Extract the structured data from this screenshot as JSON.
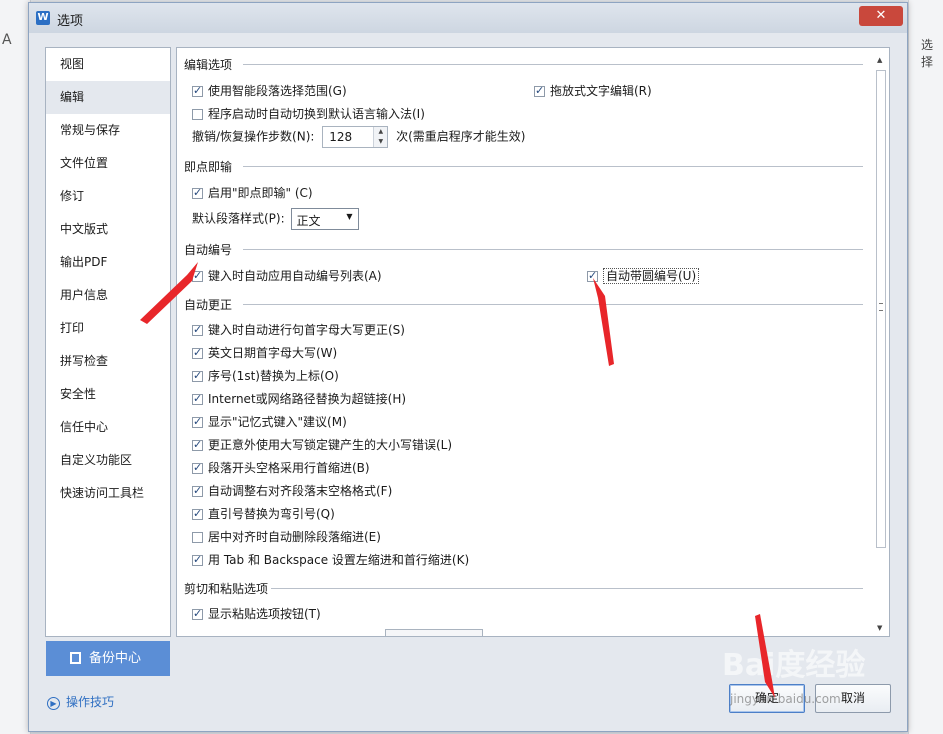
{
  "background": {
    "left_glyph": "A",
    "right_text": "选择"
  },
  "dialog": {
    "title": "选项",
    "close": "✕"
  },
  "sidebar": {
    "items": [
      "视图",
      "编辑",
      "常规与保存",
      "文件位置",
      "修订",
      "中文版式",
      "输出PDF",
      "用户信息",
      "打印",
      "拼写检查",
      "安全性",
      "信任中心",
      "自定义功能区",
      "快速访问工具栏"
    ],
    "active_index": 1
  },
  "backup_button": "备份中心",
  "tips_link": "操作技巧",
  "sections": {
    "edit_options": {
      "title": "编辑选项",
      "smart_select": {
        "label": "使用智能段落选择范围(G)",
        "checked": true
      },
      "drag_drop": {
        "label": "拖放式文字编辑(R)",
        "checked": true
      },
      "auto_ime": {
        "label": "程序启动时自动切换到默认语言输入法(I)",
        "checked": false
      },
      "undo_label": "撤销/恢复操作步数(N):",
      "undo_value": "128",
      "undo_note": "次(需重启程序才能生效)"
    },
    "click_type": {
      "title": "即点即输",
      "enable": {
        "label": "启用\"即点即输\" (C)",
        "checked": true
      },
      "default_style_label": "默认段落样式(P):",
      "default_style_value": "正文"
    },
    "auto_number": {
      "title": "自动编号",
      "apply_list": {
        "label": "键入时自动应用自动编号列表(A)",
        "checked": true
      },
      "circled": {
        "label": "自动带圆编号(U)",
        "checked": true
      }
    },
    "auto_correct": {
      "title": "自动更正",
      "items": [
        {
          "label": "键入时自动进行句首字母大写更正(S)",
          "checked": true
        },
        {
          "label": "英文日期首字母大写(W)",
          "checked": true
        },
        {
          "label": "序号(1st)替换为上标(O)",
          "checked": true
        },
        {
          "label": "Internet或网络路径替换为超链接(H)",
          "checked": true
        },
        {
          "label": "显示\"记忆式键入\"建议(M)",
          "checked": true
        },
        {
          "label": "更正意外使用大写锁定键产生的大小写错误(L)",
          "checked": true
        },
        {
          "label": "段落开头空格采用行首缩进(B)",
          "checked": true
        },
        {
          "label": "自动调整右对齐段落末空格格式(F)",
          "checked": true
        },
        {
          "label": "直引号替换为弯引号(Q)",
          "checked": true
        },
        {
          "label": "居中对齐时自动删除段落缩进(E)",
          "checked": false
        },
        {
          "label": "用 Tab 和 Backspace 设置左缩进和首行缩进(K)",
          "checked": true
        }
      ]
    },
    "paste": {
      "title": "剪切和粘贴选项",
      "show_paste_btn": {
        "label": "显示粘贴选项按钮(T)",
        "checked": true
      }
    }
  },
  "buttons": {
    "ok": "确定",
    "cancel": "取消"
  },
  "watermark": {
    "brand": "Bai度经验",
    "url": "jingyan.baidu.com"
  },
  "colors": {
    "arrow": "#e8262a",
    "accent": "#5b8ed6",
    "close": "#c9483c"
  }
}
